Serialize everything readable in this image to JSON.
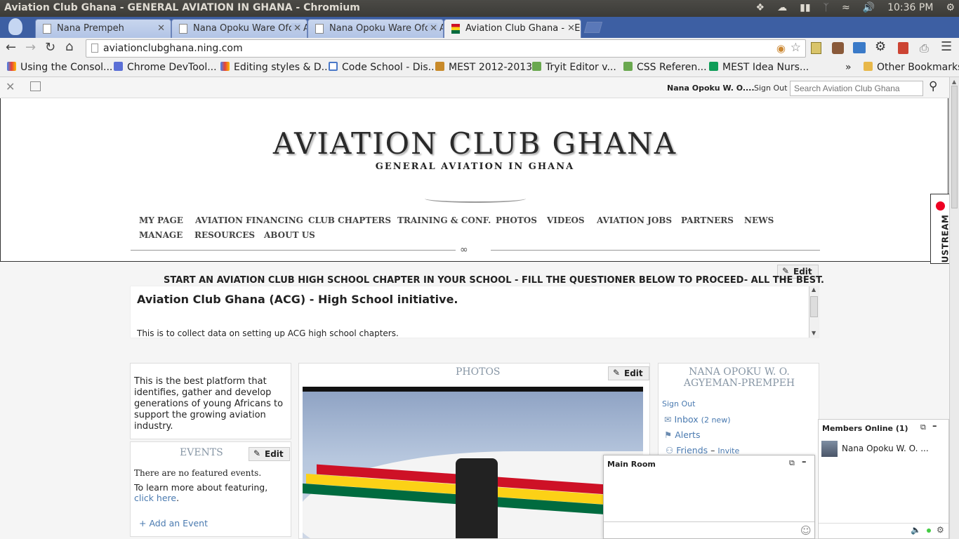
{
  "window": {
    "title": "Aviation Club Ghana - GENERAL AVIATION IN GHANA - Chromium",
    "clock": "10:36 PM"
  },
  "tabs": [
    {
      "label": "Nana Prempeh"
    },
    {
      "label": "Nana Opoku Ware Ofori A"
    },
    {
      "label": "Nana Opoku Ware Ofori A"
    },
    {
      "label": "Aviation Club Ghana - GEN"
    }
  ],
  "address": {
    "url": "aviationclubghana.ning.com"
  },
  "bookmarks": [
    {
      "label": "Using the Consol...",
      "color": "#3b78e7"
    },
    {
      "label": "Chrome DevTool...",
      "color": "#5b6fd6"
    },
    {
      "label": "Editing styles & D...",
      "color": "#3b78e7"
    },
    {
      "label": "Code School - Dis...",
      "color": "#4a78c8"
    },
    {
      "label": "MEST 2012-2013",
      "color": "#c88a2a"
    },
    {
      "label": "Tryit Editor v...",
      "color": "#6aa84f"
    },
    {
      "label": "CSS Referen...",
      "color": "#6aa84f"
    },
    {
      "label": "MEST Idea Nurs...",
      "color": "#0f9d58"
    }
  ],
  "other_bookmarks": "Other Bookmarks",
  "bookmarks_more": "»",
  "ningbar": {
    "user": "Nana Opoku W. O....",
    "signout": "Sign Out",
    "search_placeholder": "Search Aviation Club Ghana"
  },
  "site": {
    "title": "AVIATION CLUB GHANA",
    "tagline": "GENERAL AVIATION IN GHANA"
  },
  "nav": {
    "row1": [
      "MY PAGE",
      "AVIATION FINANCING",
      "CLUB CHAPTERS",
      "TRAINING & CONF.",
      "PHOTOS",
      "VIDEOS",
      "AVIATION JOBS",
      "PARTNERS",
      "NEWS"
    ],
    "row2": [
      "MANAGE",
      "RESOURCES",
      "ABOUT US"
    ]
  },
  "edit_label": "Edit",
  "announcement": "START AN AVIATION CLUB HIGH SCHOOL CHAPTER IN YOUR SCHOOL - FILL THE QUESTIONER BELOW TO PROCEED- ALL THE BEST.",
  "form": {
    "heading": "Aviation Club Ghana (ACG) - High School initiative.",
    "text": "This is to collect data on setting up ACG high school chapters."
  },
  "about": {
    "text": "This is the best platform that identifies, gather and develop generations of young Africans to support the growing aviation industry."
  },
  "events": {
    "title": "EVENTS",
    "none": "There are no featured events.",
    "learn_prefix": "To learn more about featuring,",
    "learn_link": "click here",
    "learn_suffix": ".",
    "add": "+ Add an Event"
  },
  "photos": {
    "title": "PHOTOS"
  },
  "profile": {
    "name": "NANA OPOKU W. O. AGYEMAN-PREMPEH",
    "signout": "Sign Out",
    "inbox": "Inbox",
    "inbox_new": "(2 new)",
    "alerts": "Alerts",
    "friends": "Friends",
    "invite": "Invite"
  },
  "chat": {
    "room": "Main Room",
    "members_title": "Members Online (1)",
    "member": "Nana Opoku W. O. ..."
  },
  "ustream": "USTREAM"
}
